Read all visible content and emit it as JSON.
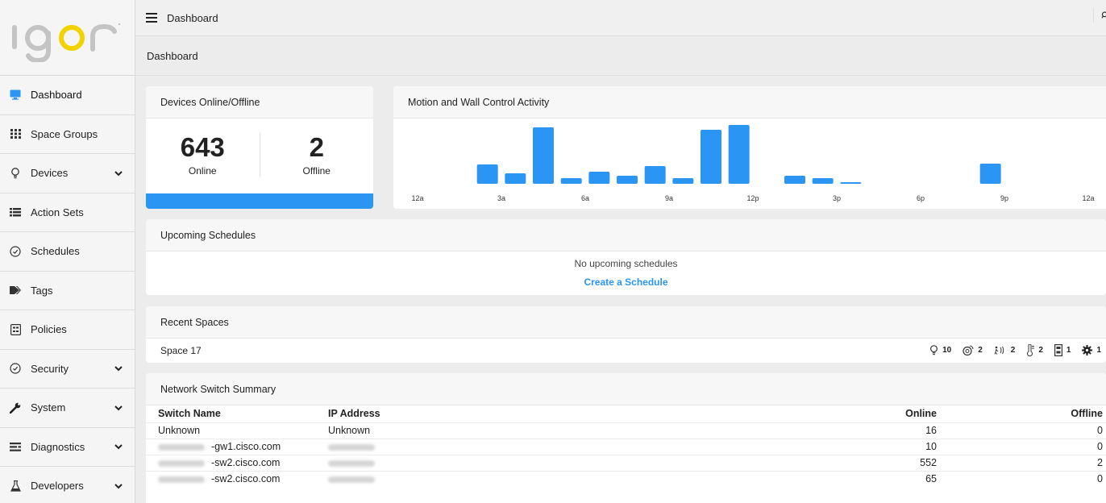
{
  "brand": {
    "logo_text": "igor"
  },
  "header": {
    "title": "Dashboard"
  },
  "breadcrumb": "Dashboard",
  "sidebar": {
    "items": [
      {
        "label": "Dashboard",
        "icon": "monitor-icon",
        "expandable": false,
        "active": true
      },
      {
        "label": "Space Groups",
        "icon": "grid-icon",
        "expandable": false
      },
      {
        "label": "Devices",
        "icon": "bulb-icon",
        "expandable": true
      },
      {
        "label": "Action Sets",
        "icon": "list-icon",
        "expandable": false
      },
      {
        "label": "Schedules",
        "icon": "clock-icon",
        "expandable": false
      },
      {
        "label": "Tags",
        "icon": "tag-icon",
        "expandable": false
      },
      {
        "label": "Policies",
        "icon": "policy-icon",
        "expandable": false
      },
      {
        "label": "Security",
        "icon": "shield-icon",
        "expandable": true
      },
      {
        "label": "System",
        "icon": "wrench-icon",
        "expandable": true
      },
      {
        "label": "Diagnostics",
        "icon": "diagnostics-icon",
        "expandable": true
      },
      {
        "label": "Developers",
        "icon": "flask-icon",
        "expandable": true
      }
    ]
  },
  "devices_card": {
    "title": "Devices Online/Offline",
    "online_count": "643",
    "online_label": "Online",
    "offline_count": "2",
    "offline_label": "Offline"
  },
  "activity_card": {
    "title": "Motion and Wall Control Activity"
  },
  "schedules_card": {
    "title": "Upcoming Schedules",
    "empty_text": "No upcoming schedules",
    "create_link": "Create a Schedule"
  },
  "recent_spaces": {
    "title": "Recent Spaces",
    "space_name": "Space 17",
    "stats": [
      {
        "icon": "bulb-icon",
        "value": "10"
      },
      {
        "icon": "sensor-icon",
        "value": "2"
      },
      {
        "icon": "motion-icon",
        "value": "2"
      },
      {
        "icon": "thermometer-icon",
        "value": "2"
      },
      {
        "icon": "wall-control-icon",
        "value": "1"
      },
      {
        "icon": "gear-icon",
        "value": "1"
      }
    ]
  },
  "network_summary": {
    "title": "Network Switch Summary",
    "columns": [
      "Switch Name",
      "IP Address",
      "Online",
      "Offline"
    ],
    "rows": [
      {
        "name": "Unknown",
        "ip": "Unknown",
        "online": "16",
        "offline": "0"
      },
      {
        "name": "-gw1.cisco.com",
        "ip": "",
        "online": "10",
        "offline": "0"
      },
      {
        "name": "-sw2.cisco.com",
        "ip": "",
        "online": "552",
        "offline": "2"
      },
      {
        "name": "-sw2.cisco.com",
        "ip": "",
        "online": "65",
        "offline": "0"
      }
    ]
  },
  "chart_data": {
    "type": "bar",
    "title": "Motion and Wall Control Activity",
    "x_tick_labels": [
      "12a",
      "3a",
      "6a",
      "9a",
      "12p",
      "3p",
      "6p",
      "9p",
      "12a"
    ],
    "hours": [
      "2a",
      "3a",
      "4a",
      "5a",
      "6a",
      "7a",
      "8a",
      "9a",
      "10a",
      "11a",
      "1p",
      "2p",
      "3p",
      "8p"
    ],
    "values": [
      24,
      13,
      70,
      7,
      15,
      10,
      22,
      7,
      67,
      73,
      10,
      7,
      1,
      25
    ],
    "color": "#2a95f3",
    "grid": false,
    "legend": "none"
  },
  "colors": {
    "accent": "#2a95f3",
    "logo_yellow": "#f2d200",
    "logo_gray": "#bdbdbd"
  }
}
